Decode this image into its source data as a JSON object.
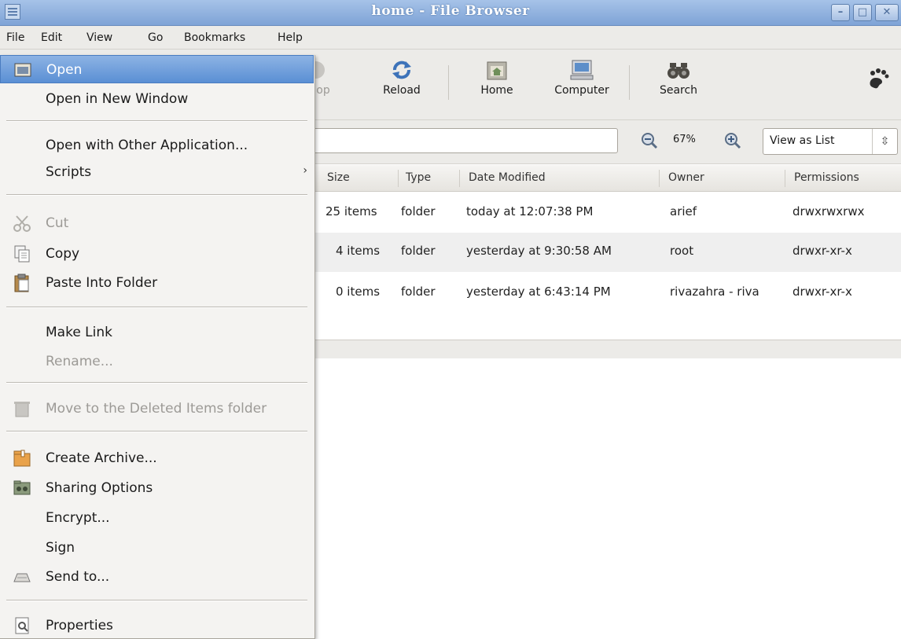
{
  "window": {
    "title": "home - File Browser",
    "min": "–",
    "max": "□",
    "close": "✕"
  },
  "menubar": {
    "file": "File",
    "edit": "Edit",
    "view": "View",
    "go": "Go",
    "bookmarks": "Bookmarks",
    "help": "Help"
  },
  "toolbar": {
    "stop": "op",
    "reload": "Reload",
    "home": "Home",
    "computer": "Computer",
    "search": "Search"
  },
  "location": {
    "zoom": "67%",
    "view_mode": "View as List"
  },
  "list": {
    "headers": {
      "size": "Size",
      "type": "Type",
      "date": "Date Modified",
      "owner": "Owner",
      "permissions": "Permissions"
    },
    "rows": [
      {
        "size": "25 items",
        "type": "folder",
        "date": "today at 12:07:38 PM",
        "owner": "arief",
        "perm": "drwxrwxrwx"
      },
      {
        "size": "4 items",
        "type": "folder",
        "date": "yesterday at 9:30:58 AM",
        "owner": "root",
        "perm": "drwxr-xr-x"
      },
      {
        "size": "0 items",
        "type": "folder",
        "date": "yesterday at 6:43:14 PM",
        "owner": "rivazahra - riva",
        "perm": "drwxr-xr-x"
      }
    ]
  },
  "context_menu": {
    "open": "Open",
    "open_new_window": "Open in New Window",
    "open_with_other": "Open with Other Application...",
    "scripts": "Scripts",
    "cut": "Cut",
    "copy": "Copy",
    "paste_into_folder": "Paste Into Folder",
    "make_link": "Make Link",
    "rename": "Rename...",
    "move_to_deleted": "Move to the Deleted Items folder",
    "create_archive": "Create Archive...",
    "sharing_options": "Sharing Options",
    "encrypt": "Encrypt...",
    "sign": "Sign",
    "send_to": "Send to...",
    "properties": "Properties"
  }
}
